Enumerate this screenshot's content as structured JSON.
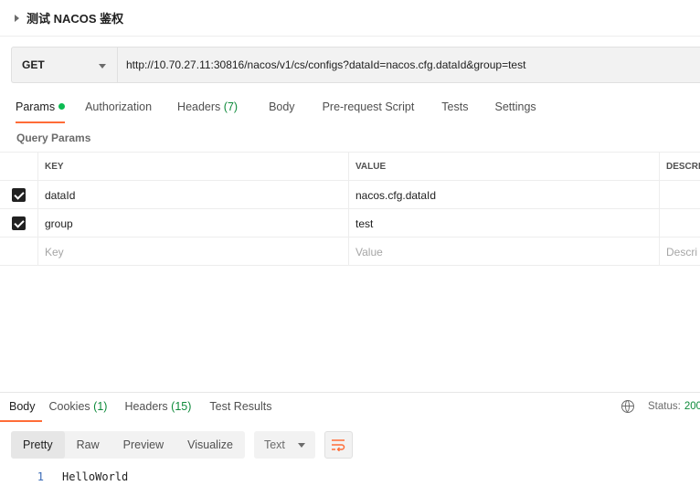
{
  "request": {
    "title": "测试 NACOS 鉴权",
    "method": "GET",
    "url": "http://10.70.27.11:30816/nacos/v1/cs/configs?dataId=nacos.cfg.dataId&group=test"
  },
  "request_tabs": [
    {
      "label": "Params",
      "active": true,
      "indicator": "dot"
    },
    {
      "label": "Authorization"
    },
    {
      "label": "Headers",
      "count": "(7)"
    },
    {
      "label": "Body"
    },
    {
      "label": "Pre-request Script"
    },
    {
      "label": "Tests"
    },
    {
      "label": "Settings"
    }
  ],
  "query_params": {
    "section_label": "Query Params",
    "columns": {
      "key": "KEY",
      "value": "VALUE",
      "description": "DESCRI"
    },
    "rows": [
      {
        "checked": true,
        "key": "dataId",
        "value": "nacos.cfg.dataId",
        "description": ""
      },
      {
        "checked": true,
        "key": "group",
        "value": "test",
        "description": ""
      }
    ],
    "placeholders": {
      "key": "Key",
      "value": "Value",
      "description": "Descri"
    }
  },
  "response_tabs": [
    {
      "label": "Body",
      "active": true
    },
    {
      "label": "Cookies",
      "count": "(1)"
    },
    {
      "label": "Headers",
      "count": "(15)"
    },
    {
      "label": "Test Results"
    }
  ],
  "status": {
    "label": "Status:",
    "value": "200",
    "icon": "globe-icon"
  },
  "view_modes": [
    {
      "label": "Pretty",
      "active": true
    },
    {
      "label": "Raw"
    },
    {
      "label": "Preview"
    },
    {
      "label": "Visualize"
    }
  ],
  "format": {
    "selected": "Text"
  },
  "wrap_icon": "wrap-lines-icon",
  "response_body": {
    "lines": [
      {
        "number": "1",
        "text": "HelloWorld"
      }
    ]
  },
  "colors": {
    "accent": "#ff6c37",
    "success": "#0d8a3a",
    "dot": "#0cbb52",
    "line_number": "#3a6bb7"
  }
}
